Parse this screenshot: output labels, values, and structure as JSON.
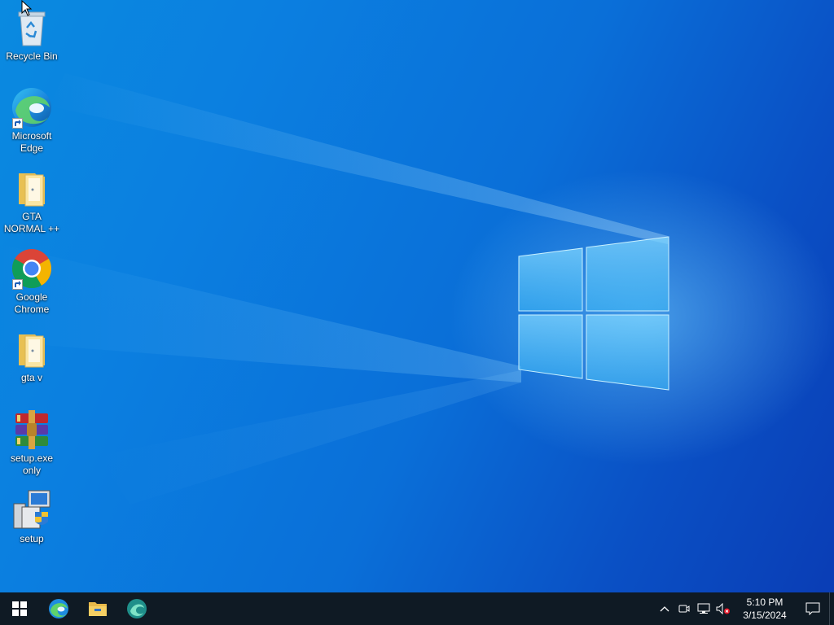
{
  "desktop": {
    "icons": [
      {
        "label": "Recycle Bin",
        "icon": "recycle-bin-icon"
      },
      {
        "label": "Microsoft Edge",
        "icon": "edge-icon"
      },
      {
        "label": "GTA NORMAL ++",
        "icon": "folder-icon"
      },
      {
        "label": "Google Chrome",
        "icon": "chrome-icon"
      },
      {
        "label": "gta v",
        "icon": "folder-icon"
      },
      {
        "label": "setup.exe only",
        "icon": "winrar-archive-icon"
      },
      {
        "label": "setup",
        "icon": "installer-icon"
      }
    ]
  },
  "taskbar": {
    "pinned": [
      "start-icon",
      "edge-icon",
      "file-explorer-icon",
      "app-icon"
    ],
    "clock": {
      "time": "5:10 PM",
      "date": "3/15/2024"
    },
    "tray": [
      "chevron-up-icon",
      "meet-now-icon",
      "network-icon",
      "volume-muted-icon",
      "notification-icon"
    ]
  },
  "colors": {
    "taskbar_bg": "#0f1a24",
    "wallpaper_blue": "#0a78d8"
  }
}
